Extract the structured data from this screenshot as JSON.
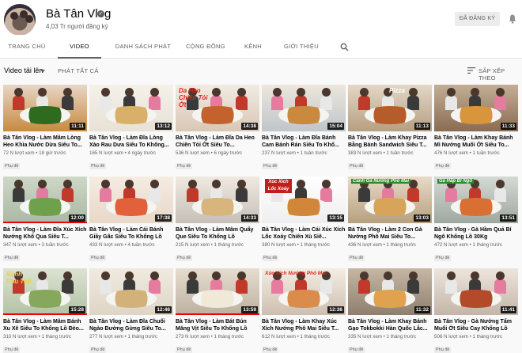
{
  "channel": {
    "name": "Bà Tân Vlog",
    "subscribers": "4,03 Tr người đăng ký",
    "subscribe_label": "ĐÃ ĐĂNG KÝ"
  },
  "tabs": [
    {
      "label": "TRANG CHỦ"
    },
    {
      "label": "VIDEO"
    },
    {
      "label": "DANH SÁCH PHÁT"
    },
    {
      "label": "CỘNG ĐỒNG"
    },
    {
      "label": "KÊNH"
    },
    {
      "label": "GIỚI THIỆU"
    }
  ],
  "filter": {
    "uploads_label": "Video tải lên",
    "play_all_label": "PHÁT TẤT CẢ",
    "sort_label": "SẮP XẾP THEO"
  },
  "videos": [
    {
      "title": "Bà Tân Vlog - Làm Mâm Lòng Heo Khìa Nước Dừa Siêu To...",
      "views": "72 N lượt xem",
      "age": "18 giờ trước",
      "duration": "11:11",
      "cc": "Phụ đề",
      "progress": 0,
      "caption": ""
    },
    {
      "title": "Bà Tân Vlog - Làm Đĩa Lòng Xào Rau Dưa Siêu To Khổng...",
      "views": "165 N lượt xem",
      "age": "4 ngày trước",
      "duration": "13:12",
      "cc": "Phụ đề",
      "progress": 0,
      "caption": ""
    },
    {
      "title": "Bà Tân Vlog - Làm Đĩa Da Heo Chiên Tỏi Ớt Siêu To...",
      "views": "536 N lượt xem",
      "age": "6 ngày trước",
      "duration": "14:38",
      "cc": "Phụ đề",
      "progress": 0,
      "caption": "Da Heo Chiên Tỏi Ớt"
    },
    {
      "title": "Bà Tân Vlog - Làm Đĩa Bánh Cam Bánh Rán Siêu To Khổ...",
      "views": "237 N lượt xem",
      "age": "1 tuần trước",
      "duration": "15:04",
      "cc": "Phụ đề",
      "progress": 0,
      "caption": ""
    },
    {
      "title": "Bà Tân Vlog - Làm Khay Pizza Bằng Bánh Sandwich Siêu T...",
      "views": "383 N lượt xem",
      "age": "1 tuần trước",
      "duration": "11:13",
      "cc": "Phụ đề",
      "progress": 0,
      "caption": "Pizza"
    },
    {
      "title": "Bà Tân Vlog - Làm Khay Bánh Mì Nướng Muối Ớt Siêu To...",
      "views": "476 N lượt xem",
      "age": "1 tuần trước",
      "duration": "11:33",
      "cc": "Phụ đề",
      "progress": 0,
      "caption": ""
    },
    {
      "title": "Bà Tân Vlog - Làm Đĩa Xúc Xích Nướng Khổ Qua Siêu T...",
      "views": "347 N lượt xem",
      "age": "3 tuần trước",
      "duration": "12:00",
      "cc": "Phụ đề",
      "progress": 1,
      "caption": ""
    },
    {
      "title": "Bà Tân Vlog - Làm Cái Bánh Giầy Gấc Siêu To Khổng Lồ",
      "views": "433 N lượt xem",
      "age": "4 tuần trước",
      "duration": "17:38",
      "cc": "Phụ đề",
      "progress": 0,
      "caption": ""
    },
    {
      "title": "Bà Tân Vlog - Làm Mâm Quẩy Que Siêu To Khổng Lồ",
      "views": "215 N lượt xem",
      "age": "1 tháng trước",
      "duration": "14:33",
      "cc": "Phụ đề",
      "progress": 0,
      "caption": ""
    },
    {
      "title": "Bà Tân Vlog - Làm Cái Xúc Xích Lốc Xoáy Chiên Xù Siê...",
      "views": "380 N lượt xem",
      "age": "1 tháng trước",
      "duration": "13:15",
      "cc": "Phụ đề",
      "progress": 0,
      "caption": "Xúc Xích Lốc Xoáy"
    },
    {
      "title": "Bà Tân Vlog - Làm 2 Con Gà Nướng Phô Mai Siêu To...",
      "views": "436 N lượt xem",
      "age": "1 tháng trước",
      "duration": "13:03",
      "cc": "Phụ đề",
      "progress": 0,
      "caption": "Cánh Gà Nướng Phô Mai"
    },
    {
      "title": "Bà Tân Vlog - Gà Hầm Quả Bí Ngô Khổng Lồ 30Kg",
      "views": "472 N lượt xem",
      "age": "1 tháng trước",
      "duration": "13:51",
      "cc": "Phụ đề",
      "progress": 0,
      "caption": "Gà Hấp Bí Ngô"
    },
    {
      "title": "Bà Tân Vlog - Làm Mâm Bánh Xu Xê Siêu To Khổng Lồ Đèo...",
      "views": "310 N lượt xem",
      "age": "1 tháng trước",
      "duration": "15:28",
      "cc": "Phụ đề",
      "progress": 1,
      "caption": "Bánh Phu Thê"
    },
    {
      "title": "Bà Tân Vlog - Làm Đĩa Chuối Ngào Đường Gừng Siêu To...",
      "views": "277 N lượt xem",
      "age": "1 tháng trước",
      "duration": "12:46",
      "cc": "Phụ đề",
      "progress": 0,
      "caption": ""
    },
    {
      "title": "Bà Tân Vlog - Làm Bát Bún Măng Vịt Siêu To Khổng Lồ",
      "views": "273 N lượt xem",
      "age": "1 tháng trước",
      "duration": "13:59",
      "cc": "Phụ đề",
      "progress": 1,
      "caption": ""
    },
    {
      "title": "Bà Tân Vlog - Làm Khay Xúc Xích Nướng Phô Mai Siêu T...",
      "views": "612 N lượt xem",
      "age": "1 tháng trước",
      "duration": "12:36",
      "cc": "Phụ đề",
      "progress": 0,
      "caption": "Xúc Xích Nướng Phô Mai"
    },
    {
      "title": "Bà Tân Vlog - Làm Khay Bánh Gạo Tokbokki Hàn Quốc Lắc...",
      "views": "335 N lượt xem",
      "age": "1 tháng trước",
      "duration": "11:32",
      "cc": "Phụ đề",
      "progress": 0,
      "caption": ""
    },
    {
      "title": "Bà Tân Vlog - Gà Nướng Tẩm Muối Ớt Siêu Cay Khổng Lồ",
      "views": "506 N lượt xem",
      "age": "1 tháng trước",
      "duration": "11:41",
      "cc": "Phụ đề",
      "progress": 0,
      "caption": ""
    }
  ],
  "colors": {
    "accent_red": "#ff0000",
    "text_secondary": "#606060",
    "subscribe_bg": "#ececec"
  }
}
